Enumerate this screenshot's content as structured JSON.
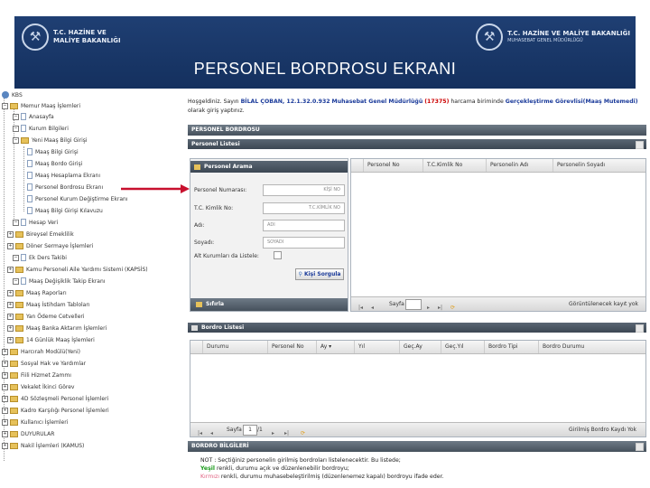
{
  "banner": {
    "left_logo_line1": "T.C. HAZİNE VE",
    "left_logo_line2": "MALİYE BAKANLIĞI",
    "right_logo_line1": "T.C. HAZİNE VE MALİYE BAKANLIĞI",
    "right_logo_line2": "MUHASEBAT GENEL MÜDÜRLÜĞÜ",
    "title": "PERSONEL BORDROSU EKRANI"
  },
  "tree": {
    "root": "KBS",
    "items": [
      "Memur Maaş İşlemleri",
      "Anasayfa",
      "Kurum Bilgileri",
      "Yeni Maaş Bilgi Girişi",
      "Maaş Bilgi Girişi",
      "Maaş Bordo Girişi",
      "Maaş Hesaplama Ekranı",
      "Personel Bordrosu Ekranı",
      "Personel Kurum Değiştirme Ekranı",
      "Maaş Bilgi Girişi Kılavuzu",
      "Hesap Veri",
      "Bireysel Emeklilik",
      "Döner Sermaye İşlemleri",
      "Ek Ders Takibi",
      "Kamu Personeli Aile Yardımı Sistemi (KAPSİS)",
      "Maaş Değişiklik Takip Ekranı",
      "Maaş Raporları",
      "Maaş İstihdam Tabloları",
      "Yan Ödeme Cetvelleri",
      "Maaş Banka Aktarım İşlemleri",
      "14 Günlük Maaş İşlemleri",
      "Harcırah Modülü(Yeni)",
      "Sosyal Hak ve Yardımlar",
      "Fiili Hizmet Zammı",
      "Vekalet İkinci Görev",
      "4D Sözleşmeli Personel İşlemleri",
      "Kadro Karşılığı Personel İşlemleri",
      "Kullanıcı İşlemleri",
      "DUYURULAR",
      "Nakil İşlemleri (KAMUS)"
    ]
  },
  "welcome": {
    "p1": "Hoşgeldiniz. Sayın ",
    "name": "BİLAL ÇOBAN, 12.1.32.0.932",
    "p2": " ",
    "office": "Muhasebat Genel Müdürlüğü",
    "code": "(17375)",
    "p3": " harcama biriminde ",
    "role": "Gerçekleştirme Görevlisi(Maaş Mutemedi)",
    "p4": " olarak giriş yaptınız."
  },
  "panels": {
    "main_header": "PERSONEL BORDROSU",
    "list_header": "Personel Listesi",
    "search_header": "Personel Arama",
    "bordro_list_header": "Bordro Listesi",
    "bordro_info_header": "BORDRO BİLGİLERİ"
  },
  "search": {
    "label_personel_no": "Personel Numarası:",
    "ph_personel_no": "KİŞİ NO",
    "label_tckn": "T.C. Kimlik No:",
    "ph_tckn": "T.C.KİMLİK NO",
    "label_ad": "Adı:",
    "ph_ad": "ADI",
    "label_soyad": "Soyadı:",
    "ph_soyad": "SOYADI",
    "label_alt": "Alt Kurumları da Listele:",
    "query_button": "Kişi Sorgula",
    "clear_button": "Sıfırla"
  },
  "personel_list": {
    "columns": [
      "Personel No",
      "T.C.Kimlik No",
      "Personelin Adı",
      "Personelin Soyadı"
    ],
    "pager_page": "Sayfa",
    "pager_status": "Görüntülenecek kayıt yok"
  },
  "bordro_list": {
    "columns": [
      "Durumu",
      "Personel No",
      "Ay ▾",
      "Yıl",
      "Geç.Ay",
      "Geç.Yıl",
      "Bordro Tipi",
      "Bordro Durumu"
    ],
    "pager_page": "Sayfa",
    "pager_value": "1",
    "pager_of": "/1",
    "pager_status": "Girilmiş Bordro Kaydı Yok"
  },
  "note": {
    "line1": "NOT : Seçtiğiniz personelin girilmiş bordroları listelenecektir. Bu listede;",
    "line2_color": "Yeşil",
    "line2_rest": " renkli, durumu açık ve düzenlenebilir bordroyu;",
    "line3_color": "Kırmızı",
    "line3_rest": " renkli, durumu muhasebeleştirilmiş (düzenlenemez kapalı) bordroyu ifade eder."
  },
  "colors": {
    "banner": "#1f3f73",
    "panel_header": "#46515c",
    "arrow": "#c8102e",
    "highlight_text": "#1a3a9a"
  }
}
